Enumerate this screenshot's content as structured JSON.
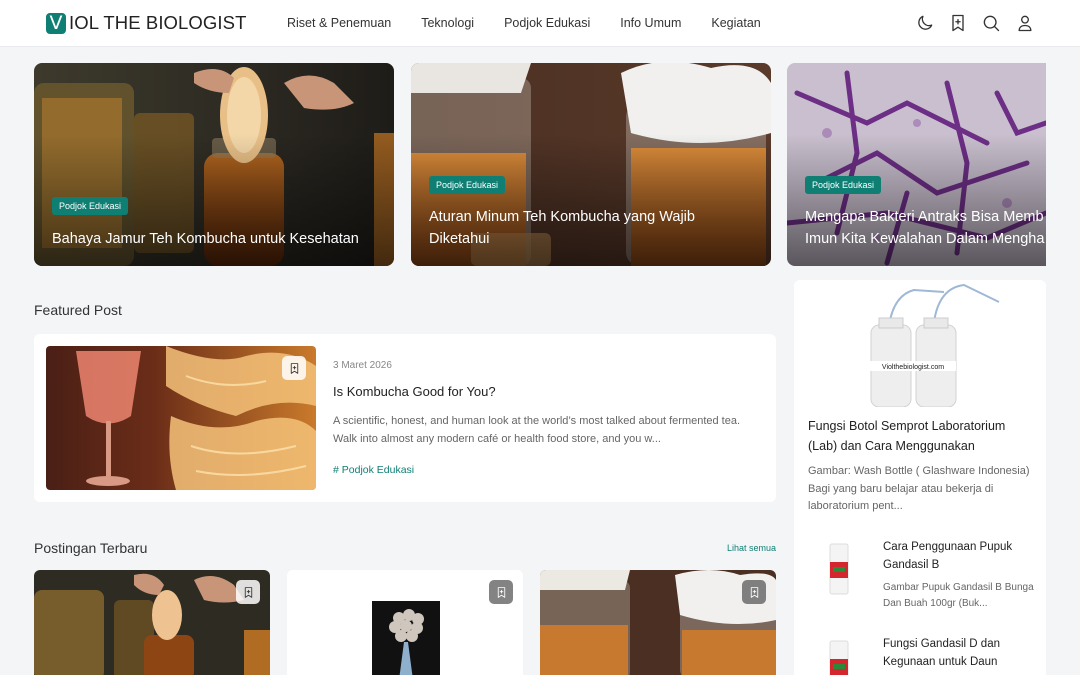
{
  "header": {
    "logo_letter": "V",
    "logo_text": "IOL THE BIOLOGIST",
    "nav": [
      "Riset & Penemuan",
      "Teknologi",
      "Podjok Edukasi",
      "Info Umum",
      "Kegiatan"
    ],
    "icons": [
      "moon-icon",
      "bookmark-icon",
      "search-icon",
      "user-icon"
    ]
  },
  "hero": [
    {
      "badge": "Podjok Edukasi",
      "title_lines": [
        "Bahaya Jamur Teh Kombucha untuk Kesehatan"
      ]
    },
    {
      "badge": "Podjok Edukasi",
      "title_lines": [
        "Aturan Minum Teh Kombucha yang Wajib",
        "Diketahui"
      ]
    },
    {
      "badge": "Podjok Edukasi",
      "title_lines": [
        "Mengapa Bakteri Antraks Bisa Memb",
        "Imun Kita Kewalahan Dalam Mengha"
      ]
    }
  ],
  "featured": {
    "section_title": "Featured Post",
    "date": "3 Maret 2026",
    "title": "Is Kombucha Good for You?",
    "excerpt": "A scientific, honest, and human look at the world’s most talked about fermented tea. Walk into almost any modern café or health food store, and you w...",
    "tag": "# Podjok Edukasi"
  },
  "latest": {
    "section_title": "Postingan Terbaru",
    "see_all": "Lihat semua"
  },
  "sidebar": {
    "image_caption": "Violthebiologist.com",
    "top_title": "Fungsi Botol Semprot Laboratorium (Lab) dan Cara Menggunakan",
    "top_excerpt": "Gambar: Wash Bottle ( Glashware Indonesia) Bagi yang baru belajar atau bekerja di laboratorium pent...",
    "items": [
      {
        "title": "Cara Penggunaan Pupuk Gandasil B",
        "excerpt": "Gambar Pupuk Gandasil B Bunga Dan Buah 100gr (Buk..."
      },
      {
        "title": "Fungsi Gandasil D dan Kegunaan untuk Daun",
        "excerpt": ""
      }
    ]
  },
  "colors": {
    "accent": "#0f7f74",
    "background": "#f4f5f7"
  }
}
